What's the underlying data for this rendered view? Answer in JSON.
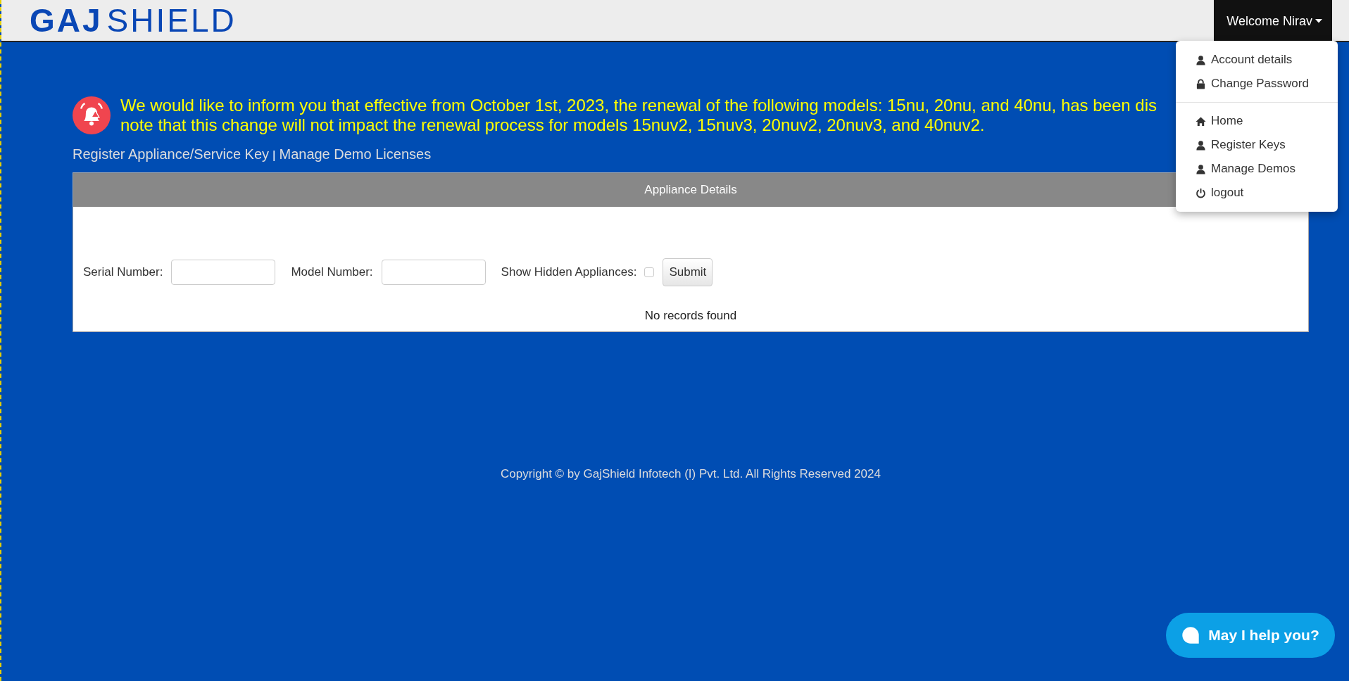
{
  "header": {
    "logo": {
      "bold": "GAJ",
      "light": "SHIELD"
    },
    "user_menu": {
      "label": "Welcome Nirav",
      "expanded": true,
      "groups": [
        {
          "items": [
            {
              "label": "Account details",
              "kind": "user"
            },
            {
              "label": "Change Password",
              "kind": "lock"
            }
          ]
        },
        {
          "items": [
            {
              "label": "Home",
              "kind": "home"
            },
            {
              "label": "Register Keys",
              "kind": "user"
            },
            {
              "label": "Manage Demos",
              "kind": "user"
            },
            {
              "label": "logout",
              "kind": "power"
            }
          ]
        }
      ]
    }
  },
  "notice": {
    "text": "We would like to inform you that effective from October 1st, 2023, the renewal of the following models: 15nu, 20nu, and 40nu, has been dis\nnote that this change will not impact the renewal process for models 15nuv2, 15nuv3, 20nuv2, 20nuv3, and 40nuv2."
  },
  "links": [
    {
      "label": "Register Appliance/Service Key"
    },
    {
      "label": "Manage Demo Licenses"
    }
  ],
  "links_separator": "|",
  "panel": {
    "title": "Appliance Details",
    "fields": [
      {
        "label": "Serial Number:",
        "kind": "text"
      },
      {
        "label": "Model Number:",
        "kind": "text"
      },
      {
        "label": "Show Hidden Appliances:",
        "kind": "checkbox",
        "checked": false
      }
    ],
    "submit": "Submit",
    "empty_message": "No records found"
  },
  "footer": "Copyright © by GajShield Infotech (I) Pvt. Ltd. All Rights Reserved 2024",
  "chat": {
    "label": "May I help you?"
  }
}
